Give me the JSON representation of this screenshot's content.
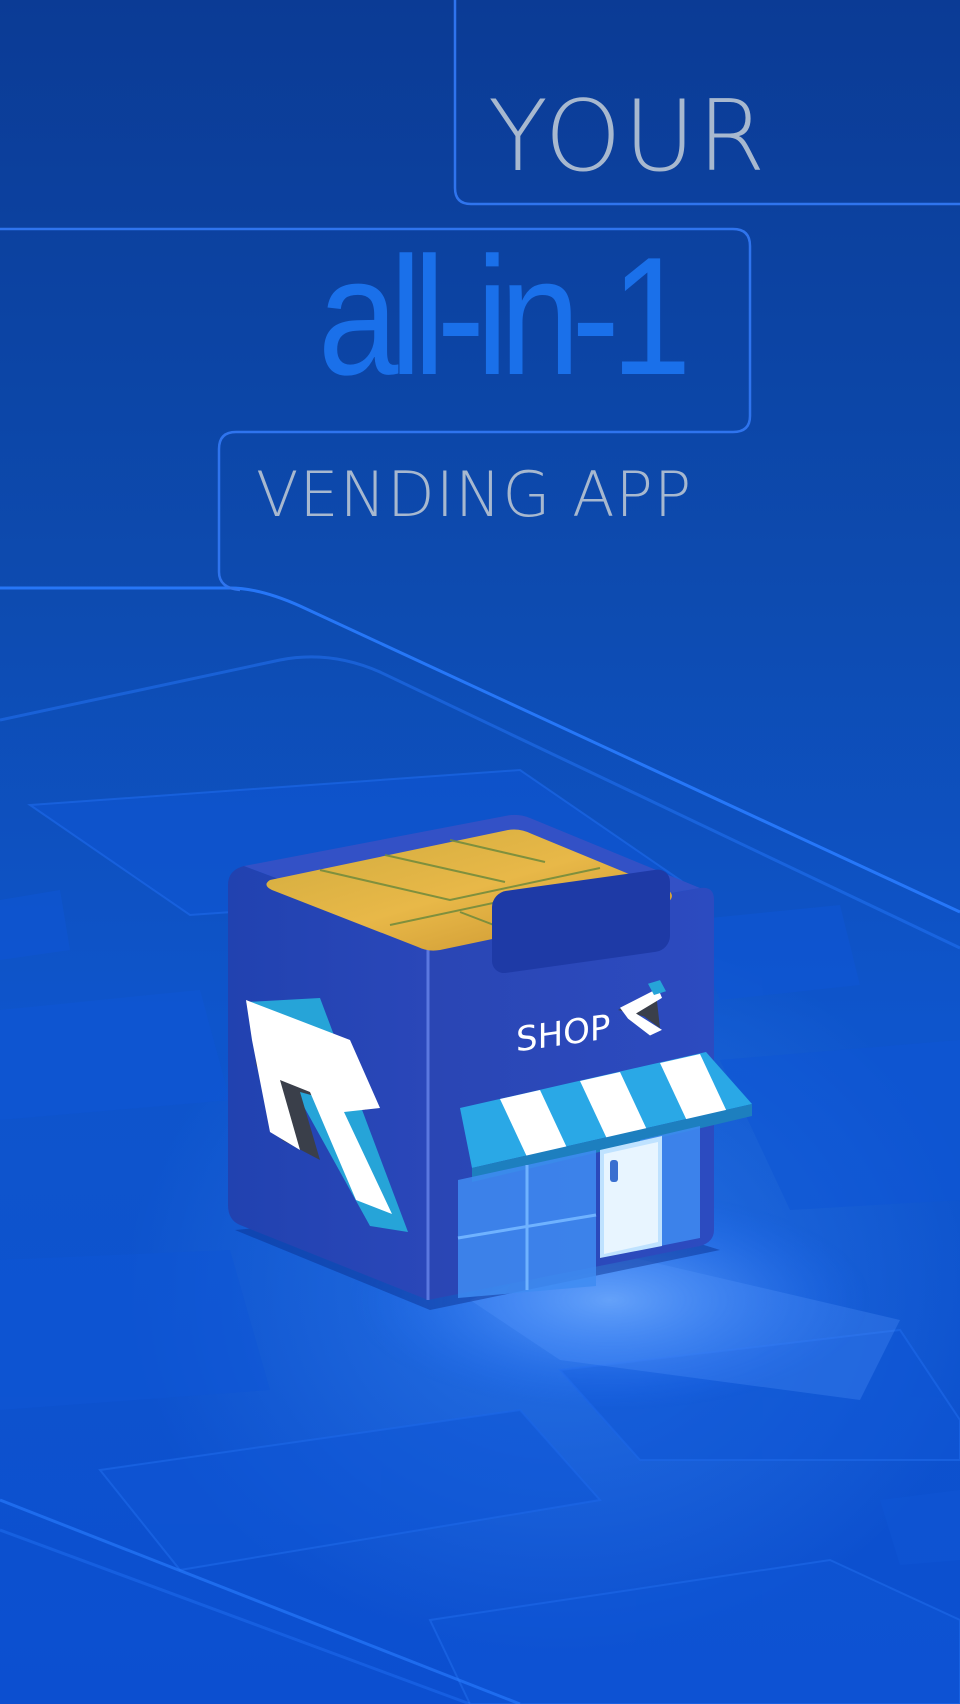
{
  "headline": {
    "line1": "YOUR",
    "line2": "all-in-1",
    "line3": "VENDING APP"
  },
  "shop": {
    "sign_label": "SHOP",
    "logo": "r-brand-logo"
  },
  "colors": {
    "background_top": "#0b3b95",
    "background_bottom": "#0c4fd0",
    "accent_blue": "#1a70ea",
    "headline_gray": "#a7b8cf",
    "chip_gold": "#e3b042",
    "awning_cyan": "#2bb3ee"
  }
}
